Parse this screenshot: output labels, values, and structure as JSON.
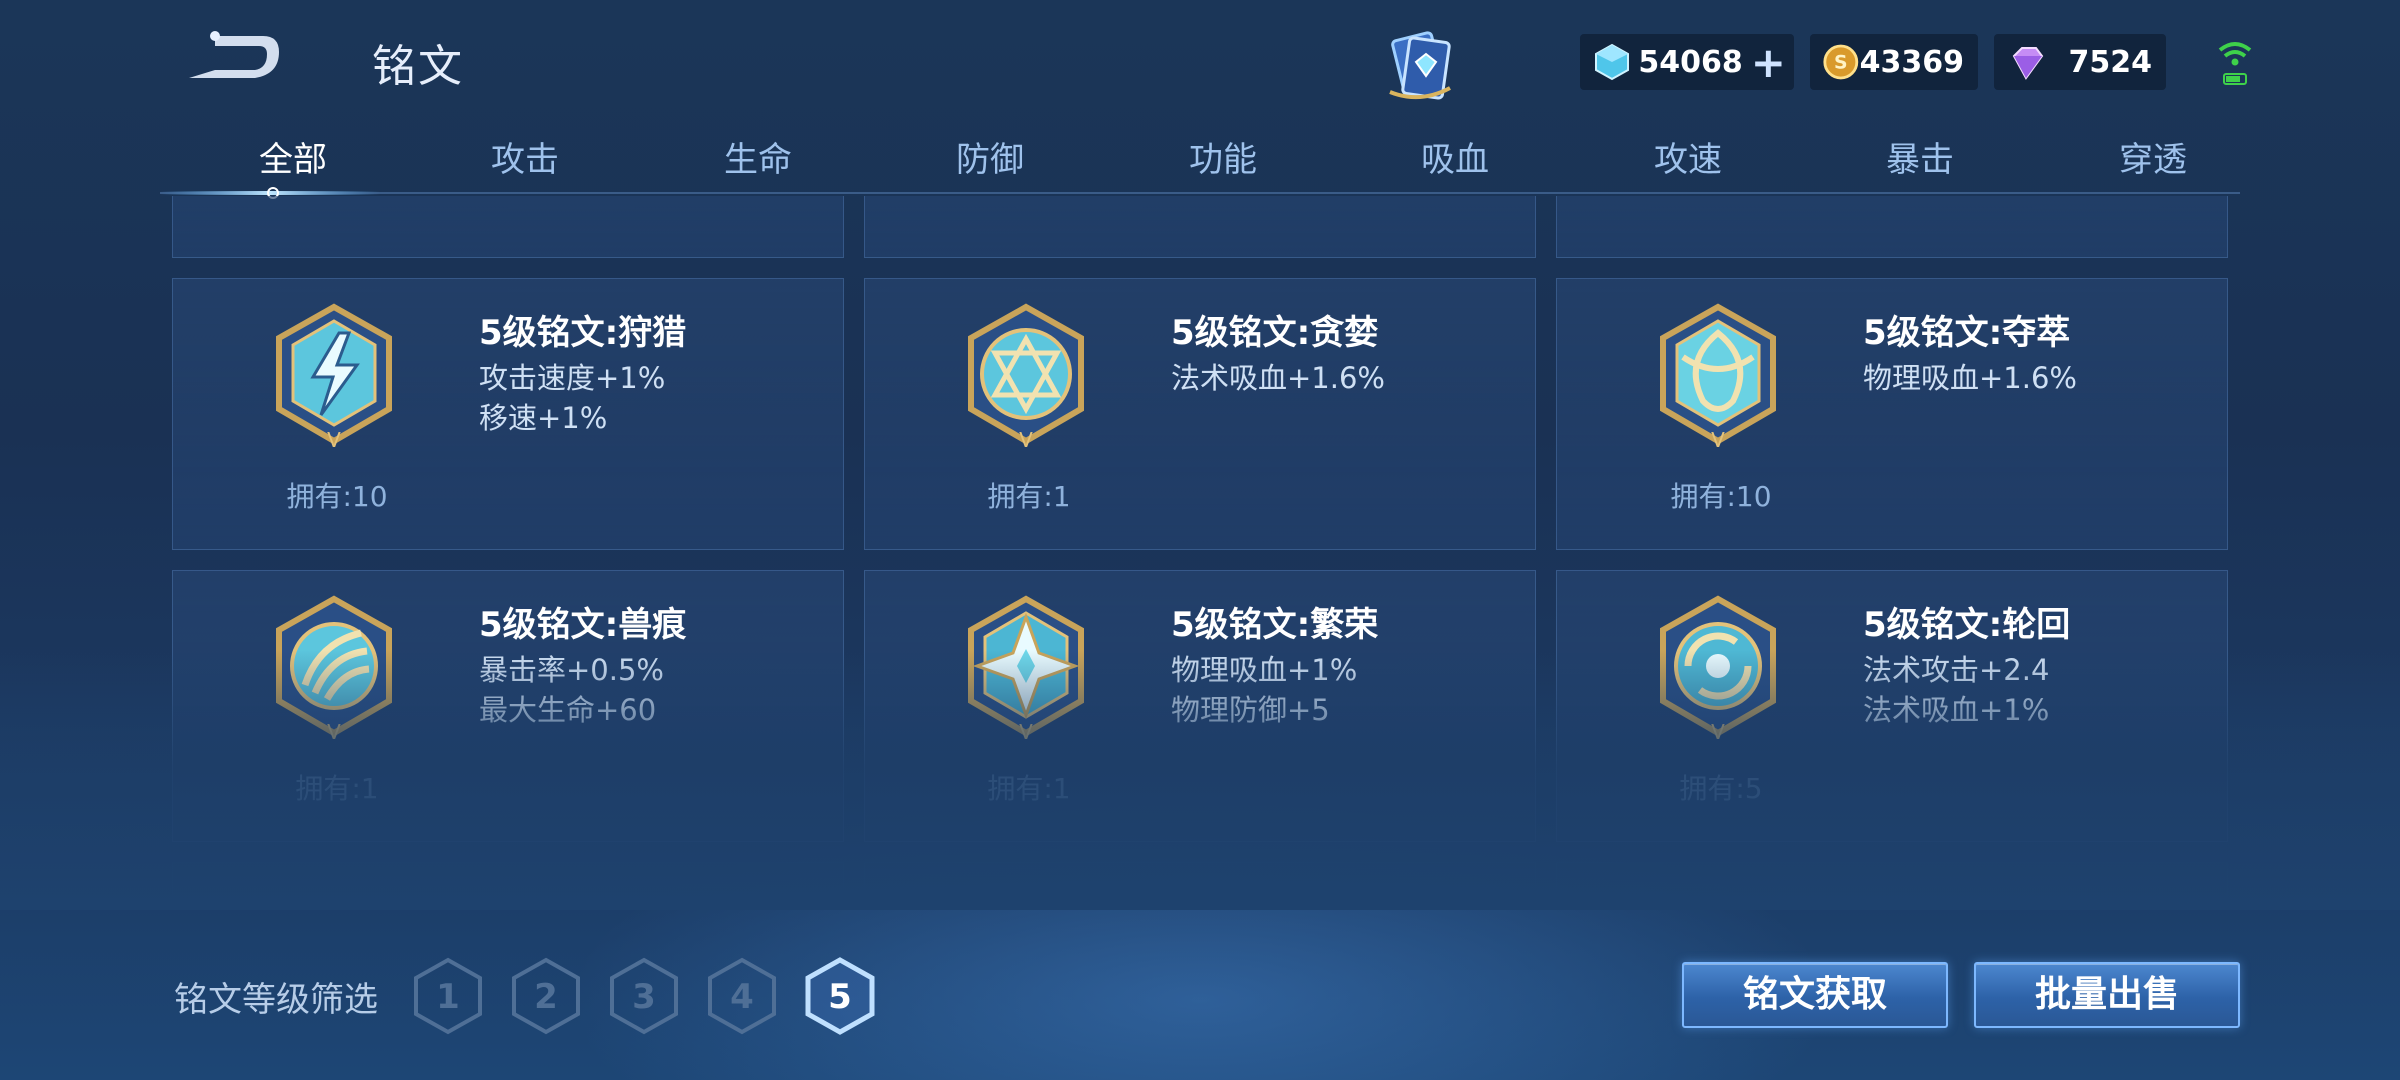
{
  "header": {
    "title": "铭文",
    "currencies": {
      "coupon": "54068",
      "gold": "43369",
      "gem": "7524"
    },
    "coupon_plus": "+"
  },
  "tabs": [
    {
      "label": "全部",
      "active": true
    },
    {
      "label": "攻击"
    },
    {
      "label": "生命"
    },
    {
      "label": "防御"
    },
    {
      "label": "功能"
    },
    {
      "label": "吸血"
    },
    {
      "label": "攻速"
    },
    {
      "label": "暴击"
    },
    {
      "label": "穿透"
    }
  ],
  "cards": [
    {
      "name": "5级铭文:狩猎",
      "stats": [
        "攻击速度+1%",
        "移速+1%"
      ],
      "owned": "拥有:10",
      "icon": "lightning-emblem-icon"
    },
    {
      "name": "5级铭文:贪婪",
      "stats": [
        "法术吸血+1.6%"
      ],
      "owned": "拥有:1",
      "icon": "star-emblem-icon"
    },
    {
      "name": "5级铭文:夺萃",
      "stats": [
        "物理吸血+1.6%"
      ],
      "owned": "拥有:10",
      "icon": "knot-emblem-icon"
    },
    {
      "name": "5级铭文:兽痕",
      "stats": [
        "暴击率+0.5%",
        "最大生命+60"
      ],
      "owned": "拥有:1",
      "icon": "claw-emblem-icon"
    },
    {
      "name": "5级铭文:繁荣",
      "stats": [
        "物理吸血+1%",
        "物理防御+5"
      ],
      "owned": "拥有:1",
      "icon": "crystal-emblem-icon"
    },
    {
      "name": "5级铭文:轮回",
      "stats": [
        "法术攻击+2.4",
        "法术吸血+1%"
      ],
      "owned": "拥有:5",
      "icon": "swirl-emblem-icon"
    }
  ],
  "footer": {
    "filter_label": "铭文等级筛选",
    "levels": [
      "1",
      "2",
      "3",
      "4",
      "5"
    ],
    "selected_level": "5",
    "get_button": "铭文获取",
    "sell_button": "批量出售"
  },
  "colors": {
    "accent": "#7db8ff",
    "button": "#2d62a8",
    "emblem_frame": "#c9a45a",
    "emblem_glass": "#7fe3ee"
  }
}
